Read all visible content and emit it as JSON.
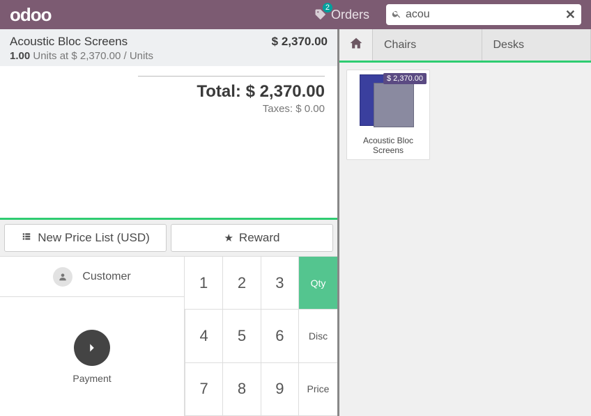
{
  "brand": "odoo",
  "topbar": {
    "orders_label": "Orders",
    "orders_badge": "2",
    "search_value": "acou"
  },
  "order": {
    "line": {
      "name": "Acoustic Bloc Screens",
      "qty": "1.00",
      "units_at_label": "Units at",
      "unit_price": "$ 2,370.00",
      "per_unit_label": "/ Units",
      "line_total": "$ 2,370.00"
    },
    "total_label": "Total:",
    "total_value": "$ 2,370.00",
    "taxes_label": "Taxes:",
    "taxes_value": "$ 0.00"
  },
  "controls": {
    "pricelist": "New Price List (USD)",
    "reward": "Reward"
  },
  "actionpad": {
    "customer_label": "Customer",
    "payment_label": "Payment"
  },
  "numpad": {
    "k1": "1",
    "k2": "2",
    "k3": "3",
    "k4": "4",
    "k5": "5",
    "k6": "6",
    "k7": "7",
    "k8": "8",
    "k9": "9",
    "qty": "Qty",
    "disc": "Disc",
    "price": "Price"
  },
  "categories": {
    "c1": "Chairs",
    "c2": "Desks"
  },
  "products": {
    "p1": {
      "name": "Acoustic Bloc Screens",
      "price": "$ 2,370.00"
    }
  }
}
